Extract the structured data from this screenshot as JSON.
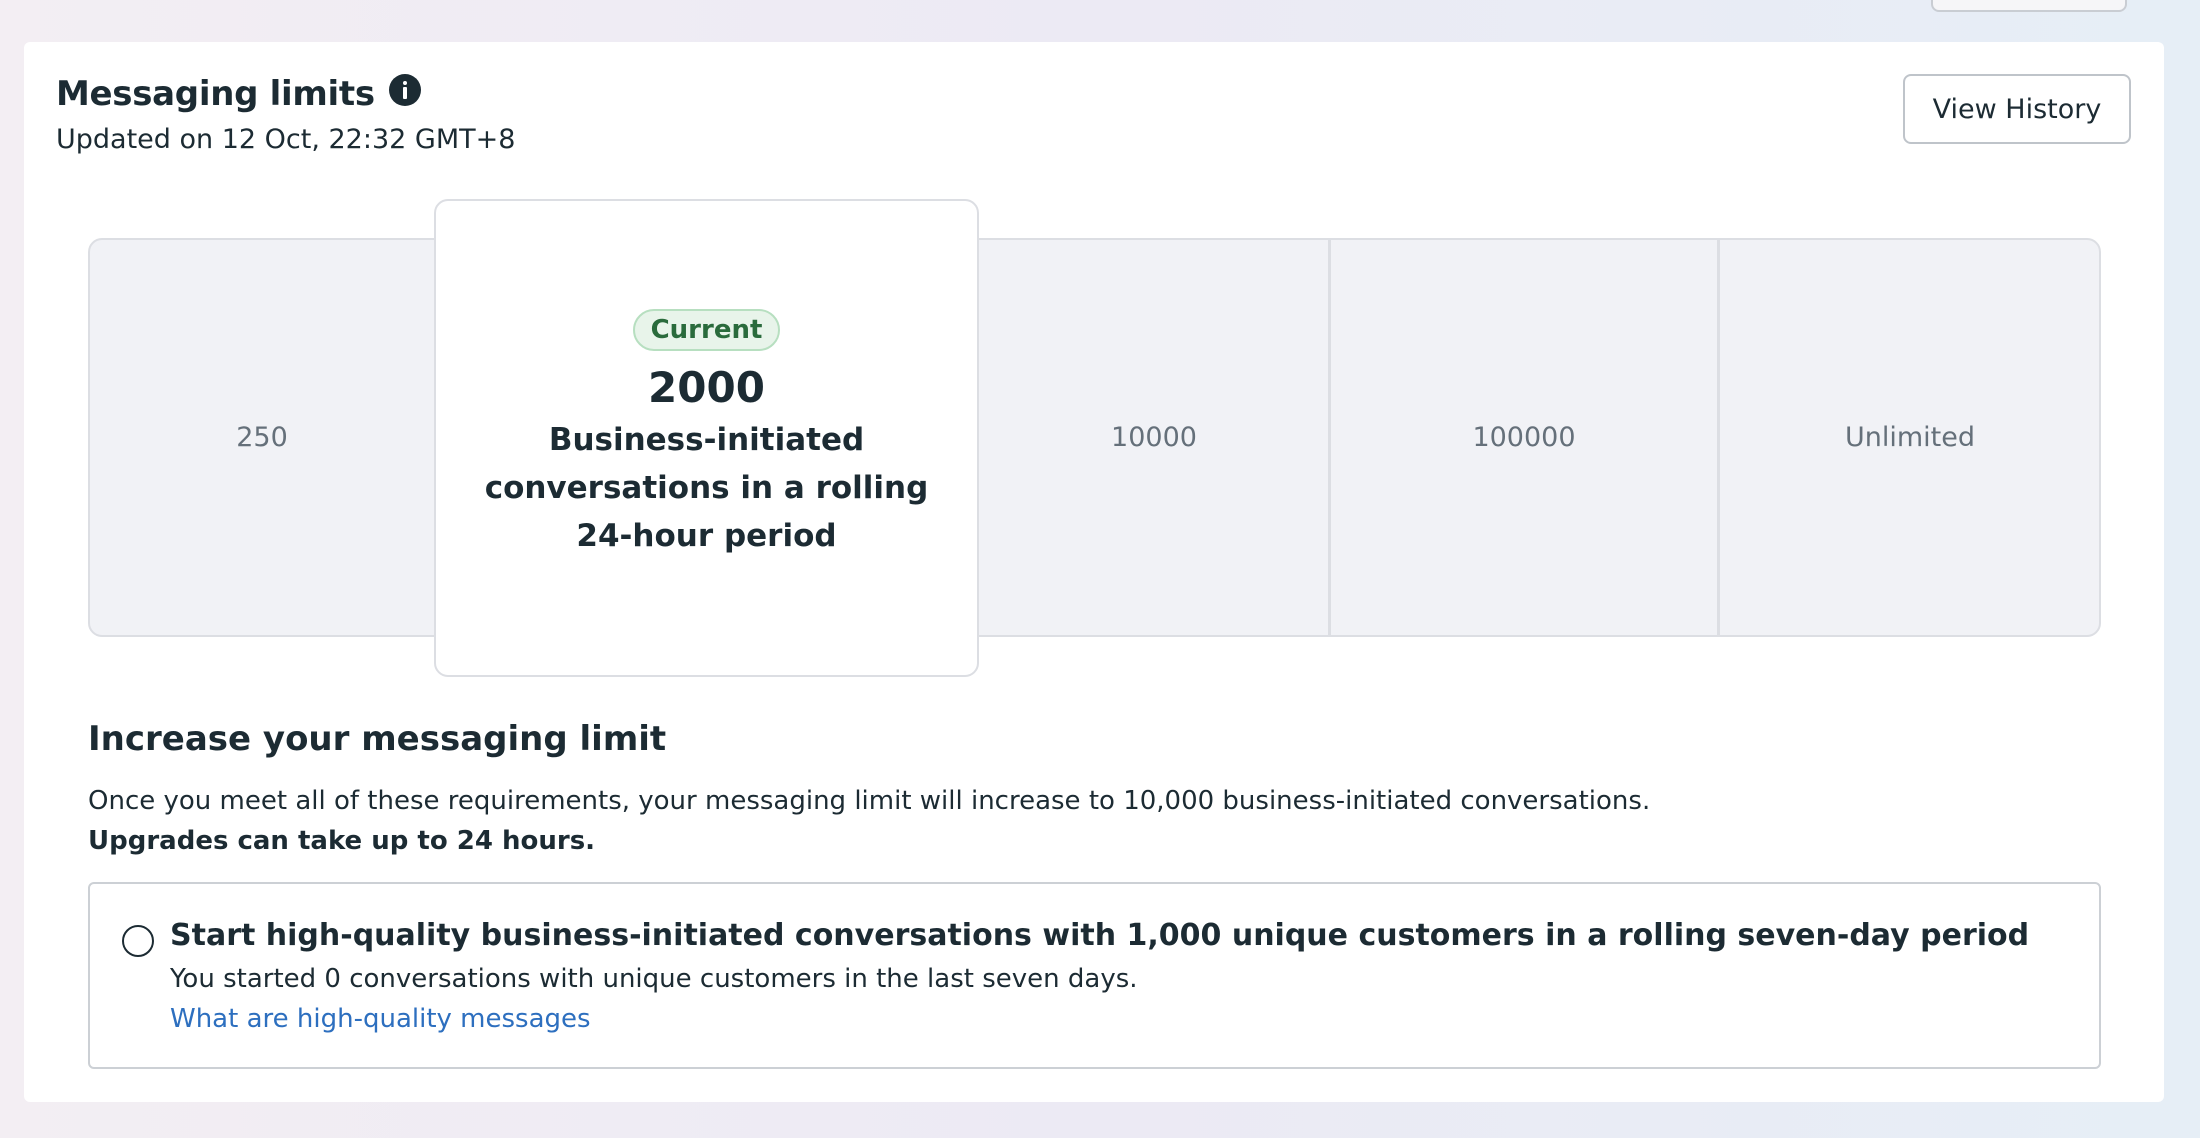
{
  "header": {
    "title": "Messaging limits",
    "info_icon": "info-icon",
    "updated": "Updated on 12 Oct, 22:32 GMT+8",
    "view_history_label": "View History"
  },
  "tiers": {
    "items": [
      {
        "label": "250"
      },
      {
        "label": "2000",
        "current": true
      },
      {
        "label": "10000"
      },
      {
        "label": "100000"
      },
      {
        "label": "Unlimited"
      }
    ],
    "current": {
      "badge": "Current",
      "value": "2000",
      "description": "Business-initiated conversations in a rolling 24-hour period"
    }
  },
  "increase": {
    "heading": "Increase your messaging limit",
    "description": "Once you meet all of these requirements, your messaging limit will increase to 10,000 business-initiated conversations.",
    "note": "Upgrades can take up to 24 hours.",
    "requirements": [
      {
        "title": "Start high-quality business-initiated conversations with 1,000 unique customers in a rolling seven-day period",
        "status": "You started 0 conversations with unique customers in the last seven days.",
        "link": "What are high-quality messages",
        "completed": false
      }
    ]
  },
  "colors": {
    "badge_green": "#2a6b3c",
    "link_blue": "#2d6fbf",
    "text": "#1c2b33"
  }
}
